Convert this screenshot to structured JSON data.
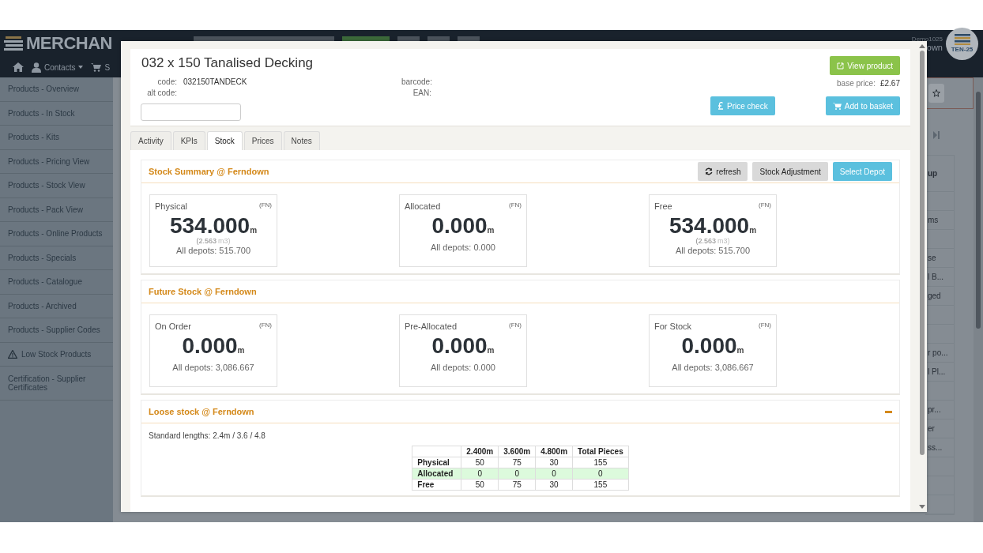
{
  "navbar": {
    "logo": "MERCHAN",
    "nav": [
      {
        "label": "Contacts",
        "kind": "contacts"
      },
      {
        "label": "S",
        "kind": "cart"
      }
    ],
    "user": "Demo1025",
    "location": "own",
    "badge": "TEN-25"
  },
  "sidebar": {
    "items": [
      {
        "label": "Products - Overview",
        "kind": "link"
      },
      {
        "label": "Products - In Stock",
        "kind": "link"
      },
      {
        "label": "Products - Kits",
        "kind": "link"
      },
      {
        "label": "Products - Pricing View",
        "kind": "link"
      },
      {
        "label": "Products - Stock View",
        "kind": "link"
      },
      {
        "label": "Products - Pack View",
        "kind": "link"
      },
      {
        "label": "Products - Online Products",
        "kind": "link"
      },
      {
        "label": "Products - Specials",
        "kind": "link"
      },
      {
        "label": "Products - Catalogue",
        "kind": "link"
      },
      {
        "label": "Products - Archived",
        "kind": "link"
      },
      {
        "label": "Products - Supplier Codes",
        "kind": "link"
      },
      {
        "label": "Low Stock Products",
        "kind": "warning"
      },
      {
        "label": "Certification - Supplier Certificates",
        "kind": "link"
      }
    ]
  },
  "background_table": {
    "header": "up",
    "cells": [
      {},
      {
        "text": "ms"
      },
      {},
      {
        "text": "se"
      },
      {
        "text": "l B..."
      },
      {
        "text": "ged"
      },
      {},
      {},
      {
        "text": "r po..."
      },
      {
        "text": "l Pl..."
      },
      {},
      {
        "text": "pr..."
      },
      {
        "text": "er"
      },
      {
        "text": "ss..."
      },
      {},
      {},
      {}
    ]
  },
  "modal": {
    "title": "032 x 150 Tanalised Decking",
    "fields": [
      {
        "label": "code:",
        "value": "032150TANDECK"
      },
      {
        "label": "alt code:"
      }
    ],
    "other_fields": [
      {
        "label": "barcode:"
      },
      {
        "label": "EAN:"
      }
    ],
    "base_price": {
      "label": "base price:",
      "value": "£2.67"
    },
    "view_button": "View product",
    "price_check_button": "Price check",
    "basket_button": "Add to basket",
    "tabs": [
      {
        "label": "Activity",
        "selected": false
      },
      {
        "label": "KPIs",
        "selected": false
      },
      {
        "label": "Stock",
        "selected": true
      },
      {
        "label": "Prices",
        "selected": false
      },
      {
        "label": "Notes",
        "selected": false
      }
    ],
    "sections": [
      {
        "kind": "cards",
        "title": "Stock Summary @ Ferndown",
        "actions": [
          {
            "label": "refresh",
            "kind": "refresh"
          },
          {
            "label": "Stock Adjustment",
            "kind": "default"
          },
          {
            "label": "Select Depot",
            "kind": "primary"
          }
        ],
        "cards": [
          {
            "label": "Physical",
            "tag": "(FN)",
            "value": "534.000",
            "unit": "m",
            "volume": "(2.563",
            "volume_unit": "m3)",
            "all_depots": "All depots: 515.700"
          },
          {
            "label": "Allocated",
            "tag": "(FN)",
            "value": "0.000",
            "unit": "m",
            "all_depots": "All depots: 0.000"
          },
          {
            "label": "Free",
            "tag": "(FN)",
            "value": "534.000",
            "unit": "m",
            "volume": "(2.563",
            "volume_unit": "m3)",
            "all_depots": "All depots: 515.700"
          }
        ]
      },
      {
        "kind": "cards",
        "title": "Future Stock @ Ferndown",
        "cards": [
          {
            "label": "On Order",
            "tag": "(FN)",
            "value": "0.000",
            "unit": "m",
            "all_depots": "All depots: 3,086.667"
          },
          {
            "label": "Pre-Allocated",
            "tag": "(FN)",
            "value": "0.000",
            "unit": "m",
            "all_depots": "All depots: 0.000"
          },
          {
            "label": "For Stock",
            "tag": "(FN)",
            "value": "0.000",
            "unit": "m",
            "all_depots": "All depots: 3,086.667"
          }
        ]
      },
      {
        "kind": "table",
        "title": "Loose stock @ Ferndown",
        "collapsible": true,
        "note": "Standard lengths: 2.4m / 3.6 / 4.8",
        "columns": [
          "2.400m",
          "3.600m",
          "4.800m",
          "Total Pieces"
        ],
        "rows": [
          {
            "label": "Physical",
            "highlighted": false,
            "cells": [
              "50",
              "75",
              "30",
              "155"
            ]
          },
          {
            "label": "Allocated",
            "highlighted": true,
            "cells": [
              "0",
              "0",
              "0",
              "0"
            ]
          },
          {
            "label": "Free",
            "highlighted": false,
            "cells": [
              "50",
              "75",
              "30",
              "155"
            ]
          }
        ]
      }
    ]
  }
}
